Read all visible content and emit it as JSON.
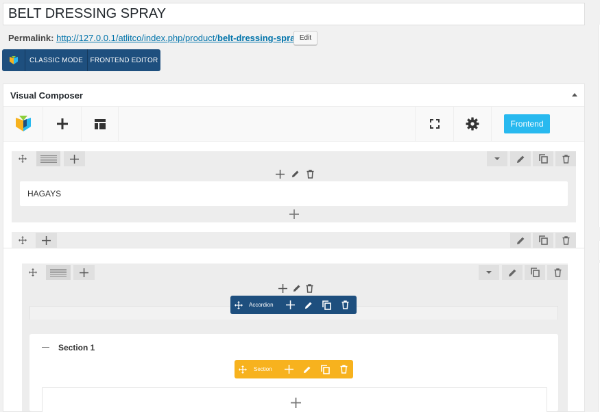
{
  "post": {
    "title": "BELT DRESSING SPRAY"
  },
  "permalink": {
    "label": "Permalink:",
    "url_base": "http://127.0.0.1/atlitco/index.php/product/",
    "slug": "belt-dressing-spray",
    "url_end": "/",
    "edit_label": "Edit"
  },
  "mode_bar": {
    "logo_icon": "visual-composer-logo-icon",
    "classic_label": "CLASSIC MODE",
    "frontend_label": "FRONTEND EDITOR"
  },
  "composer": {
    "title": "Visual Composer",
    "toolbar": {
      "logo_icon": "visual-composer-logo-icon",
      "add_icon": "plus-icon",
      "templates_icon": "layout-template-icon",
      "fullscreen_icon": "fullscreen-icon",
      "settings_icon": "gear-icon",
      "frontend_label": "Frontend"
    },
    "rows": [
      {
        "column_text": "HAGAYS"
      },
      {},
      {
        "accordion_label": "Accordion",
        "section_title": "Section 1",
        "section_label": "Section"
      }
    ]
  },
  "colors": {
    "brand_blue": "#1e4f7e",
    "frontend_cyan": "#28b9ef",
    "section_yellow": "#f7b21e",
    "link_blue": "#0073aa"
  }
}
